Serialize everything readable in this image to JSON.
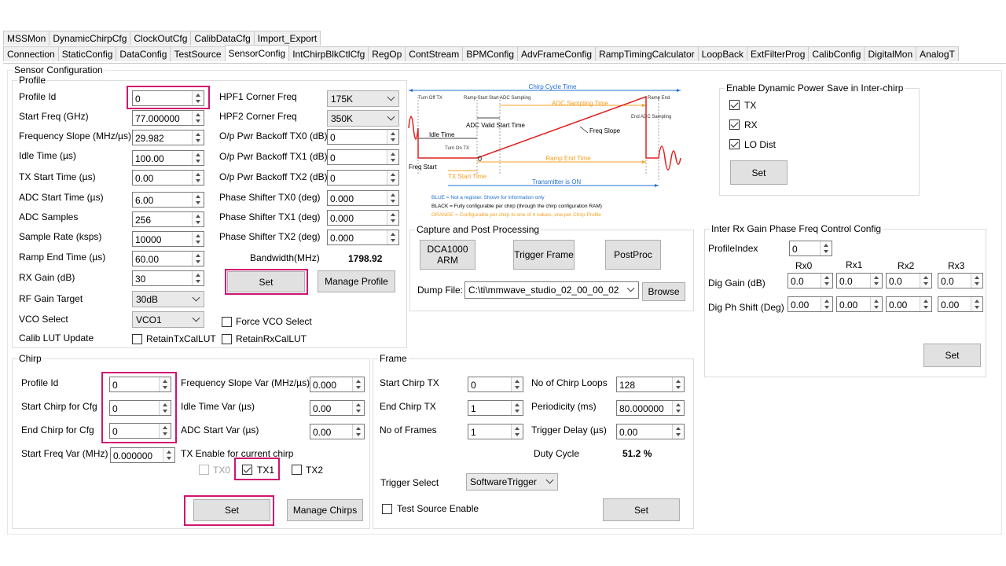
{
  "tabs_row1": [
    "MSSMon",
    "DynamicChirpCfg",
    "ClockOutCfg",
    "CalibDataCfg",
    "Import_Export"
  ],
  "tabs_row2": [
    "Connection",
    "StaticConfig",
    "DataConfig",
    "TestSource",
    "SensorConfig",
    "IntChirpBlkCtlCfg",
    "RegOp",
    "ContStream",
    "BPMConfig",
    "AdvFrameConfig",
    "RampTimingCalculator",
    "LoopBack",
    "ExtFilterProg",
    "CalibConfig",
    "DigitalMon",
    "AnalogT"
  ],
  "active_tab": "SensorConfig",
  "sensor_config": {
    "title": "Sensor Configuration",
    "profile": {
      "title": "Profile",
      "labels": {
        "profile_id": "Profile Id",
        "start_freq": "Start Freq (GHz)",
        "freq_slope": "Frequency Slope (MHz/µs)",
        "idle_time": "Idle Time (µs)",
        "tx_start_time": "TX Start Time (µs)",
        "adc_start_time": "ADC Start Time (µs)",
        "adc_samples": "ADC Samples",
        "sample_rate": "Sample Rate (ksps)",
        "ramp_end_time": "Ramp End Time (µs)",
        "rx_gain": "RX Gain (dB)",
        "rf_gain_target": "RF Gain Target",
        "vco_select": "VCO Select",
        "calib_lut_update": "Calib LUT Update",
        "hpf1": "HPF1 Corner Freq",
        "hpf2": "HPF2 Corner Freq",
        "op_pwr_tx0": "O/p Pwr Backoff TX0 (dB)",
        "op_pwr_tx1": "O/p Pwr Backoff TX1 (dB)",
        "op_pwr_tx2": "O/p Pwr Backoff TX2 (dB)",
        "ps_tx0": "Phase Shifter TX0 (deg)",
        "ps_tx1": "Phase Shifter TX1 (deg)",
        "ps_tx2": "Phase Shifter TX2 (deg)",
        "bandwidth": "Bandwidth(MHz)"
      },
      "values": {
        "profile_id": "0",
        "start_freq": "77.000000",
        "freq_slope": "29.982",
        "idle_time": "100.00",
        "tx_start_time": "0.00",
        "adc_start_time": "6.00",
        "adc_samples": "256",
        "sample_rate": "10000",
        "ramp_end_time": "60.00",
        "rx_gain": "30",
        "rf_gain_target": "30dB",
        "vco_select": "VCO1",
        "hpf1": "175K",
        "hpf2": "350K",
        "op_pwr_tx0": "0",
        "op_pwr_tx1": "0",
        "op_pwr_tx2": "0",
        "ps_tx0": "0.000",
        "ps_tx1": "0.000",
        "ps_tx2": "0.000",
        "bandwidth": "1798.92"
      },
      "force_vco_select": "Force VCO Select",
      "retain_tx": "RetainTxCalLUT",
      "retain_rx": "RetainRxCalLUT",
      "set_label": "Set",
      "manage_label": "Manage Profile"
    },
    "diagram": {
      "chirp_cycle_time": "Chirp Cycle Time",
      "turn_off_tx": "Turn Off TX",
      "ramp_start": "Ramp Start",
      "start_adc_sampling": "Start ADC Sampling",
      "ramp_end": "Ramp End",
      "adc_sampling_time": "ADC Sampling Time",
      "end_adc_sampling": "End ADC Sampling",
      "adc_valid_start_time": "ADC Valid Start Time",
      "freq_slope": "Freq Slope",
      "idle_time": "Idle Time",
      "turn_on_tx": "Turn On TX",
      "zero": "0",
      "freq_start": "Freq Start",
      "ramp_end_time": "Ramp End Time",
      "tx_start_time": "TX Start Time",
      "transmitter_on": "Transmitter is ON",
      "legend_blue": "BLUE = Not a register. Shown for information only",
      "legend_black": "BLACK = Fully configurable per chirp (through the chirp configuration RAM)",
      "legend_orange": "ORANGE = Configurable per chirp to one of 4 values, one per Chirp Profile",
      "color_blue": "#1f6fd1",
      "color_orange": "#f5a020",
      "color_red": "#e02020"
    },
    "dynamic_power": {
      "title": "Enable Dynamic Power Save in Inter-chirp",
      "tx": "TX",
      "rx": "RX",
      "lo_dist": "LO Dist",
      "set_label": "Set"
    },
    "capture": {
      "title": "Capture and Post Processing",
      "dca_label": "DCA1000 ARM",
      "trigger_label": "Trigger Frame",
      "postproc_label": "PostProc",
      "dump_file_label": "Dump File:",
      "dump_file_value": "C:\\ti\\mmwave_studio_02_00_00_02",
      "browse_label": "Browse"
    },
    "inter_rx": {
      "title": "Inter Rx Gain Phase Freq Control Config",
      "profile_index_label": "ProfileIndex",
      "profile_index_value": "0",
      "rx_headers": [
        "Rx0",
        "Rx1",
        "Rx2",
        "Rx3"
      ],
      "dig_gain_label": "Dig Gain (dB)",
      "dig_gain_values": [
        "0.0",
        "0.0",
        "0.0",
        "0.0"
      ],
      "dig_ph_label": "Dig Ph Shift (Deg)",
      "dig_ph_values": [
        "0.00",
        "0.00",
        "0.00",
        "0.00"
      ],
      "set_label": "Set"
    },
    "chirp": {
      "title": "Chirp",
      "labels": {
        "profile_id": "Profile Id",
        "start_chirp": "Start Chirp for Cfg",
        "end_chirp": "End Chirp for Cfg",
        "start_freq_var": "Start Freq Var (MHz)",
        "freq_slope_var": "Frequency Slope Var (MHz/µs)",
        "idle_time_var": "Idle Time Var (µs)",
        "adc_start_var": "ADC Start Var (µs)",
        "tx_enable": "TX Enable for current chirp"
      },
      "values": {
        "profile_id": "0",
        "start_chirp": "0",
        "end_chirp": "0",
        "start_freq_var": "0.000000",
        "freq_slope_var": "0.000",
        "idle_time_var": "0.00",
        "adc_start_var": "0.00"
      },
      "tx0": "TX0",
      "tx1": "TX1",
      "tx2": "TX2",
      "set_label": "Set",
      "manage_label": "Manage Chirps"
    },
    "frame": {
      "title": "Frame",
      "labels": {
        "start_chirp_tx": "Start Chirp TX",
        "end_chirp_tx": "End Chirp TX",
        "no_frames": "No of Frames",
        "chirp_loops": "No of Chirp Loops",
        "periodicity": "Periodicity (ms)",
        "trigger_delay": "Trigger Delay (µs)",
        "duty_cycle": "Duty Cycle",
        "trigger_select": "Trigger Select"
      },
      "values": {
        "start_chirp_tx": "0",
        "end_chirp_tx": "1",
        "no_frames": "1",
        "chirp_loops": "128",
        "periodicity": "80.000000",
        "trigger_delay": "0.00",
        "duty_cycle": "51.2 %",
        "trigger_select": "SoftwareTrigger"
      },
      "test_source": "Test Source Enable",
      "set_label": "Set"
    }
  }
}
